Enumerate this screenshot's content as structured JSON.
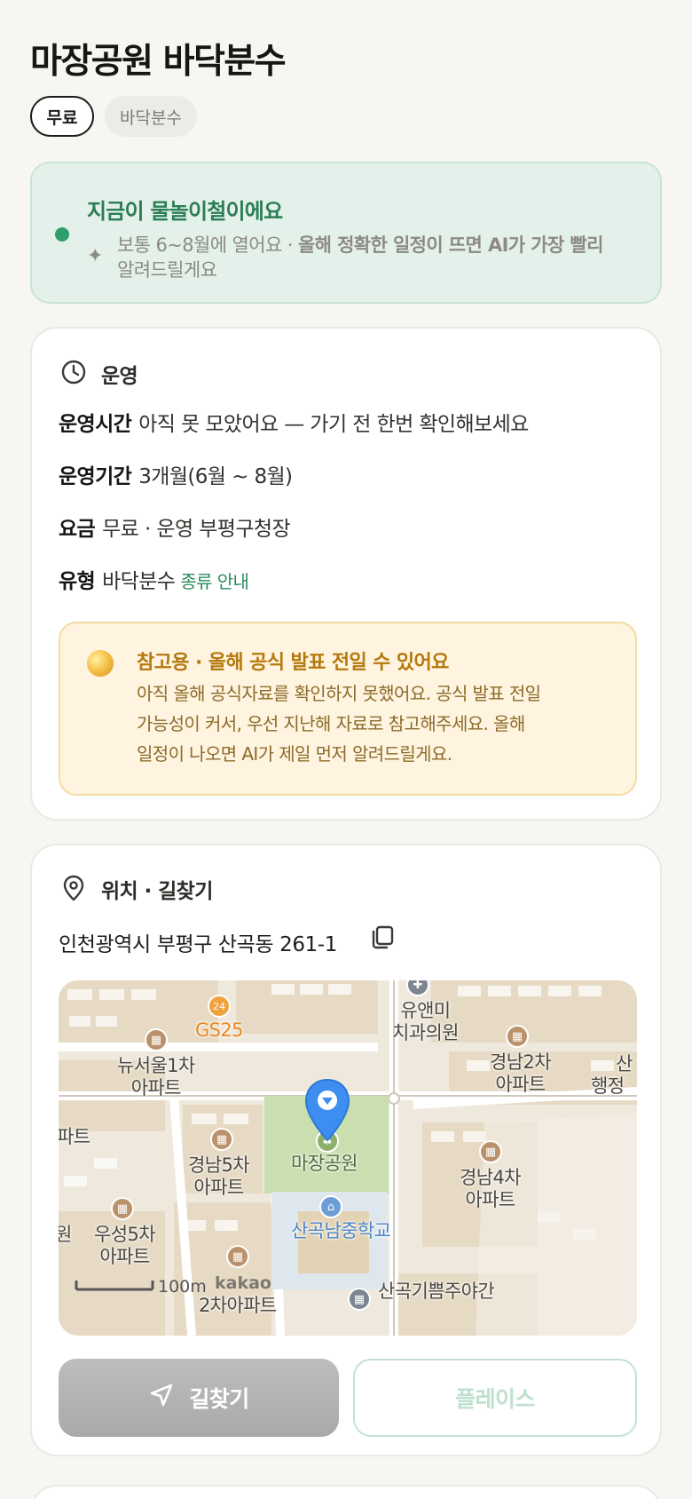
{
  "header": {
    "title": "마장공원 바닥분수"
  },
  "chips": {
    "free": "무료",
    "type": "바닥분수"
  },
  "season_banner": {
    "title": "지금이 물놀이철이에요",
    "desc_prefix": "보통 6~8월에 열어요 · ",
    "desc_bold": "올해 정확한 일정이 뜨면 AI가 가장 빨리",
    "desc_suffix": "알려드릴게요",
    "accent_color": "#2f9e6a"
  },
  "operation": {
    "section_title": "운영",
    "hours_key": "운영시간",
    "hours_value": "아직 못 모았어요 — 가기 전 한번 확인해보세요",
    "period_key": "운영기간",
    "period_value": "3개월(6월 ~ 8월)",
    "fee_key": "요금",
    "fee_value": "무료 · 운영 부평구청장",
    "type_key": "유형",
    "type_value": "바닥분수",
    "type_link": "종류 안내"
  },
  "notice": {
    "title": "참고용 · 올해 공식 발표 전일 수 있어요",
    "line1": "아직 올해 공식자료를 확인하지 못했어요. 공식 발표 전일",
    "line2": "가능성이 커서, 우선 지난해 자료로 참고해주세요. 올해",
    "line3": "일정이 나오면 AI가 제일 먼저 알려드릴게요."
  },
  "location": {
    "section_title": "위치 · 길찾기",
    "address": "인천광역시 부평구 산곡동 261-1"
  },
  "map": {
    "labels": {
      "gs25": "GS25",
      "dental_1": "유앤미",
      "dental_2": "치과의원",
      "newseoul_1": "뉴서울1차",
      "newseoul_2": "아파트",
      "gyeongnam2_1": "경남2차",
      "gyeongnam2_2": "아파트",
      "admin_1": "산",
      "admin_2": "행정",
      "apt_edge": "파트",
      "gyeongnam5_1": "경남5차",
      "gyeongnam5_2": "아파트",
      "park": "마장공원",
      "gyeongnam4_1": "경남4차",
      "gyeongnam4_2": "아파트",
      "school": "산곡남중학교",
      "won_edge": "원",
      "useong_1": "우성5차",
      "useong_2": "아파트",
      "scale": "100m",
      "kakao": "kakao",
      "apt2": "2차아파트",
      "clinic": "산곡기쁨주야간"
    },
    "gs_badge": "24"
  },
  "actions": {
    "directions": "길찾기",
    "place": "플레이스"
  }
}
